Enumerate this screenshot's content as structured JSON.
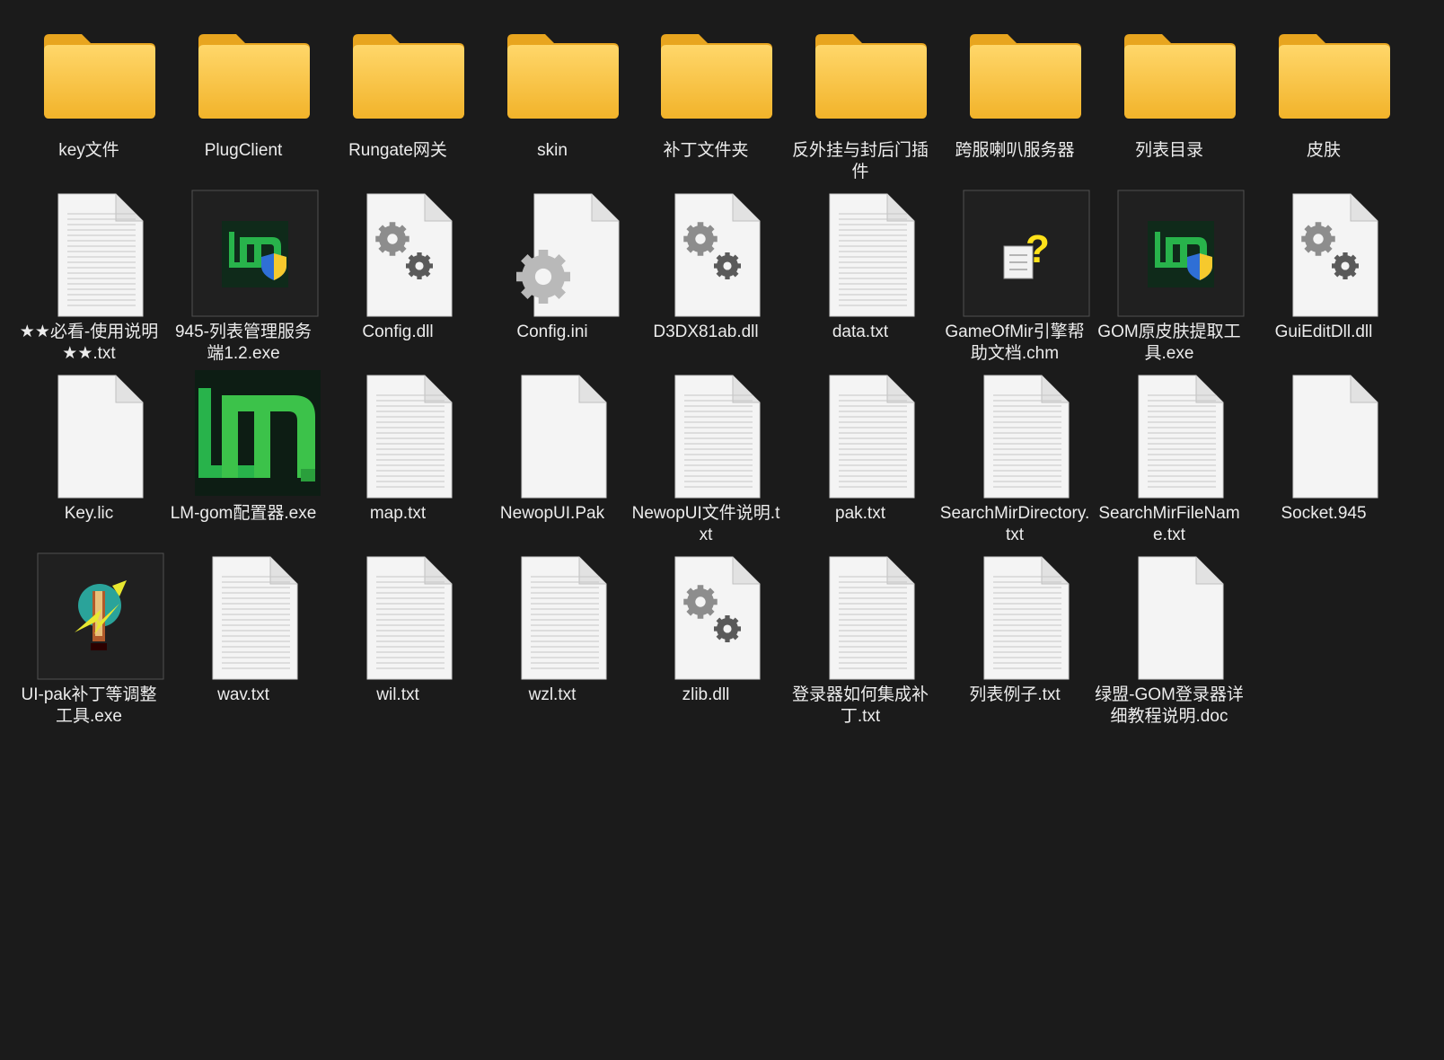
{
  "window": {
    "view": "Large icons"
  },
  "colors": {
    "background": "#1b1b1b",
    "label_text": "#ececec",
    "folder_light": "#ffd76a",
    "folder_dark": "#f2b32a",
    "page": "#f4f4f4",
    "gear": "#8a8a8a",
    "lm_green": "#28b34b"
  },
  "files": [
    {
      "name": "key文件",
      "icon": "folder-icon"
    },
    {
      "name": "PlugClient",
      "icon": "folder-icon"
    },
    {
      "name": "Rungate网关",
      "icon": "folder-app-icon"
    },
    {
      "name": "skin",
      "icon": "folder-icon"
    },
    {
      "name": "补丁文件夹",
      "icon": "folder-icon"
    },
    {
      "name": "反外挂与封后门插件",
      "icon": "folder-settings-icon"
    },
    {
      "name": "跨服喇叭服务器",
      "icon": "folder-document-icon"
    },
    {
      "name": "列表目录",
      "icon": "folder-icon"
    },
    {
      "name": "皮肤",
      "icon": "folder-app-icon"
    },
    {
      "name": "★★必看-使用说明★★.txt",
      "icon": "text-file-icon"
    },
    {
      "name": "945-列表管理服务端1.2.exe",
      "icon": "lm-shield-exe-icon"
    },
    {
      "name": "Config.dll",
      "icon": "dll-gear-icon"
    },
    {
      "name": "Config.ini",
      "icon": "ini-settings-icon"
    },
    {
      "name": "D3DX81ab.dll",
      "icon": "dll-gear-icon"
    },
    {
      "name": "data.txt",
      "icon": "text-file-icon"
    },
    {
      "name": "GameOfMir引擎帮助文档.chm",
      "icon": "chm-help-icon"
    },
    {
      "name": "GOM原皮肤提取工具.exe",
      "icon": "lm-shield-exe-icon"
    },
    {
      "name": "GuiEditDll.dll",
      "icon": "dll-gear-icon"
    },
    {
      "name": "Key.lic",
      "icon": "blank-file-icon"
    },
    {
      "name": "LM-gom配置器.exe",
      "icon": "lm-logo-exe-icon"
    },
    {
      "name": "map.txt",
      "icon": "text-file-icon"
    },
    {
      "name": "NewopUI.Pak",
      "icon": "blank-file-icon"
    },
    {
      "name": "NewopUI文件说明.txt",
      "icon": "text-file-icon"
    },
    {
      "name": "pak.txt",
      "icon": "text-file-icon"
    },
    {
      "name": "SearchMirDirectory.txt",
      "icon": "text-file-icon"
    },
    {
      "name": "SearchMirFileName.txt",
      "icon": "text-file-icon"
    },
    {
      "name": "Socket.945",
      "icon": "blank-file-icon"
    },
    {
      "name": "UI-pak补丁等调整工具.exe",
      "icon": "tool-exe-icon"
    },
    {
      "name": "wav.txt",
      "icon": "text-file-icon"
    },
    {
      "name": "wil.txt",
      "icon": "text-file-icon"
    },
    {
      "name": "wzl.txt",
      "icon": "text-file-icon"
    },
    {
      "name": "zlib.dll",
      "icon": "dll-gear-icon"
    },
    {
      "name": "登录器如何集成补丁.txt",
      "icon": "text-file-icon"
    },
    {
      "name": "列表例子.txt",
      "icon": "text-file-icon"
    },
    {
      "name": "绿盟-GOM登录器详细教程说明.doc",
      "icon": "blank-file-icon"
    }
  ]
}
